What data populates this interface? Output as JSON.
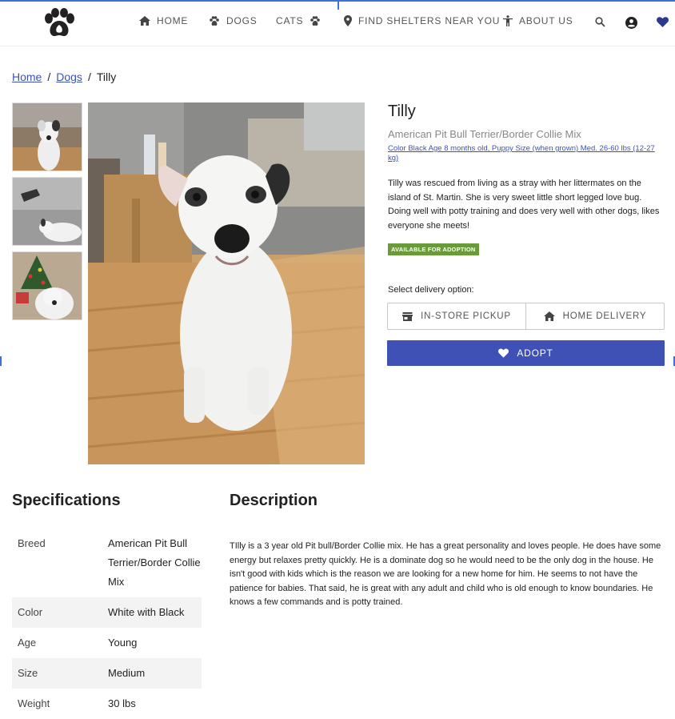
{
  "nav": {
    "items": [
      {
        "label": "HOME",
        "icon": "home-icon"
      },
      {
        "label": "DOGS",
        "icon": "paw-icon"
      },
      {
        "label": "CATS",
        "icon": "paw-icon"
      },
      {
        "label": "FIND SHELTERS NEAR YOU",
        "icon": "location-pin-icon"
      },
      {
        "label": "ABOUT US",
        "icon": "person-icon"
      }
    ],
    "right_icons": [
      "search-icon",
      "account-icon",
      "heart-icon"
    ]
  },
  "breadcrumb": {
    "home": "Home",
    "dogs": "Dogs",
    "current": "Tilly",
    "separator": "/"
  },
  "product": {
    "name": "Tilly",
    "breed": "American Pit Bull Terrier/Border Collie Mix",
    "attributes": "Color Black Age 8 months old, Puppy Size (when grown) Med. 26-60 lbs (12-27 kg)",
    "blurb": "Tilly was rescued from living as a stray with her littermates on the island of St. Martin. She is very sweet little short legged love bug. Doing well with potty training and does very well with other dogs, likes everyone she meets!",
    "status_badge": "AVAILABLE FOR ADOPTION",
    "delivery_label": "Select delivery option:",
    "delivery_options": [
      "IN-STORE PICKUP",
      "HOME DELIVERY"
    ],
    "adopt_label": "ADOPT"
  },
  "specifications": {
    "title": "Specifications",
    "rows": [
      {
        "key": "Breed",
        "value": "American Pit Bull Terrier/Border Collie Mix"
      },
      {
        "key": "Color",
        "value": "White with Black"
      },
      {
        "key": "Age",
        "value": "Young"
      },
      {
        "key": "Size",
        "value": "Medium"
      },
      {
        "key": "Weight",
        "value": "30 lbs"
      }
    ]
  },
  "description": {
    "title": "Description",
    "body": "TIlly is a 3 year old Pit bull/Border Collie mix. He has a great personality and loves people. He does have some energy but relaxes pretty quickly. He is a dominate dog so he would need to be the only dog in the house. He isn't good with kids which is the reason we are looking for a new home for him. He seems to not have the patience for babies. That said, he is great with any adult and child who is old enough to know boundaries. He knows a few commands and is potty trained."
  },
  "colors": {
    "accent": "#3f51b5",
    "badge": "#6a9a3a",
    "frame": "#3f6fd8"
  }
}
